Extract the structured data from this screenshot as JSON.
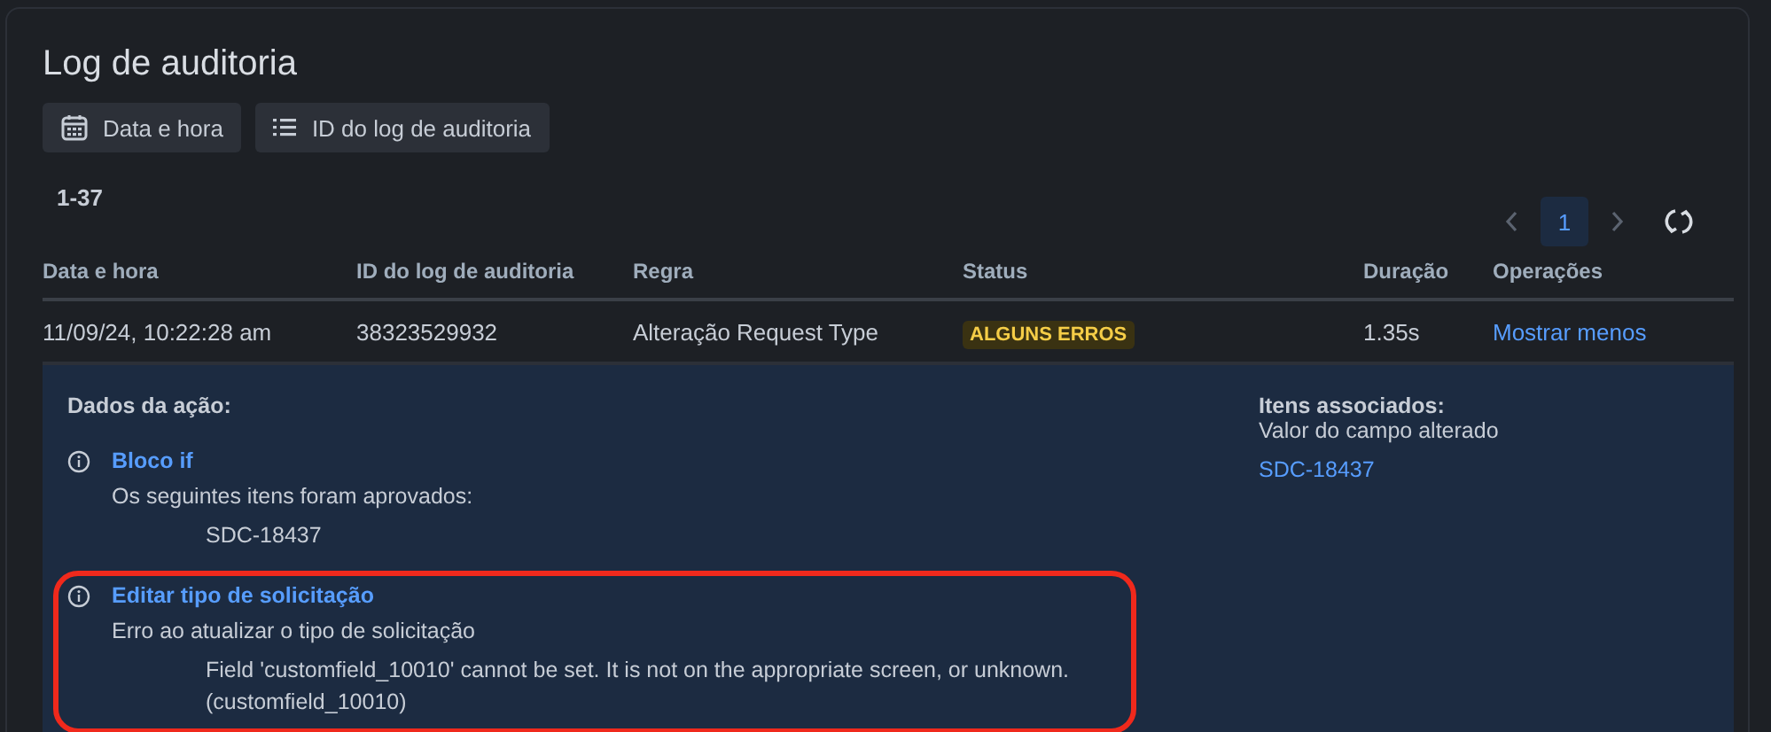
{
  "title": "Log de auditoria",
  "filters": [
    {
      "label": "Data e hora",
      "kind": "calendar"
    },
    {
      "label": "ID do log de auditoria",
      "kind": "list"
    }
  ],
  "range": "1-37",
  "pagination": {
    "pages": [
      {
        "label": "1",
        "selected": true
      }
    ]
  },
  "table": {
    "columns": [
      "Data e hora",
      "ID do log de auditoria",
      "Regra",
      "Status",
      "Duração",
      "Operações"
    ],
    "rows": [
      {
        "date": "11/09/24, 10:22:28 am",
        "id": "38323529932",
        "rule": "Alteração Request Type",
        "status": "ALGUNS ERROS",
        "duration": "1.35s",
        "operation": "Mostrar menos",
        "expanded": true
      }
    ]
  },
  "details": {
    "heading": "Dados da ação:",
    "entries": [
      {
        "title": "Bloco if",
        "description": "Os seguintes itens foram aprovados:",
        "items": [
          "SDC-18437"
        ],
        "highlighted": false
      },
      {
        "title": "Editar tipo de solicitação",
        "description": "Erro ao atualizar o tipo de solicitação",
        "items": [
          "Field 'customfield_10010' cannot be set. It is not on the appropriate screen, or unknown. (customfield_10010)"
        ],
        "highlighted": true
      }
    ],
    "associated": {
      "heading": "Itens associados:",
      "subtitle": "Valor do campo alterado",
      "links": [
        "SDC-18437"
      ]
    }
  }
}
